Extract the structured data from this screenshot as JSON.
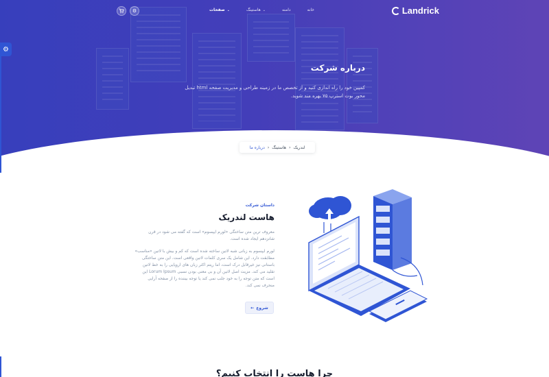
{
  "nav": {
    "brand": "Landrick",
    "menu": [
      {
        "label": "خانه",
        "active": false,
        "dropdown": false
      },
      {
        "label": "دامنه",
        "active": false,
        "dropdown": false
      },
      {
        "label": "هاستینگ",
        "active": false,
        "dropdown": true
      },
      {
        "label": "صفحات",
        "active": true,
        "dropdown": true
      }
    ],
    "icons": [
      "cart-icon",
      "settings-icon"
    ]
  },
  "side_tab": {
    "icon": "gear-icon"
  },
  "hero": {
    "title": "درباره شرکت",
    "description": "کمپین خود را راه اندازی کنید و از تخصص ما در زمینه طراحی و مدیریت صفحه html تبدیل محور بوت استرپ ۷۵ بهره مند شوید."
  },
  "breadcrumb": {
    "items": [
      "لندریک",
      "هاستینگ"
    ],
    "current": "درباره ما"
  },
  "about": {
    "kicker": "داستان شرکت",
    "title": "هاست لندریک",
    "paragraph1": "معروف ترین متن ساختگی «لورم ایپسوم» است که گفته می شود در قرن شانزدهم ایجاد شده است.",
    "paragraph2": "لورم ایپسوم به زبانی شبه لاتین ساخته شده است که کم و بیش با لاتین «مناسب» مطابقت دارد. این شامل یک سری کلمات لاتین واقعی است. این متن ساختگی باستانی نیز غیرقابل درک است، اما ریتم اکثر زبان های اروپایی را به خط لاتین تقلید می کند. مزیت اصل لاتین آن و بی معنی بودن نسبی Lorum Ipsum این است که متن توجه را به خود جلب نمی کند یا توجه بیننده را از صفحه آرایی منحرف نمی کند.",
    "button_label": "شروع",
    "button_icon": "arrow-left-icon"
  },
  "next_section": {
    "title": "چرا هاست را انتخاب کنیم؟"
  },
  "colors": {
    "primary": "#2f55d4",
    "hero_start": "#3b45c7",
    "hero_end": "#6b4bc0",
    "heading": "#161c2d",
    "muted": "#8492a6"
  }
}
